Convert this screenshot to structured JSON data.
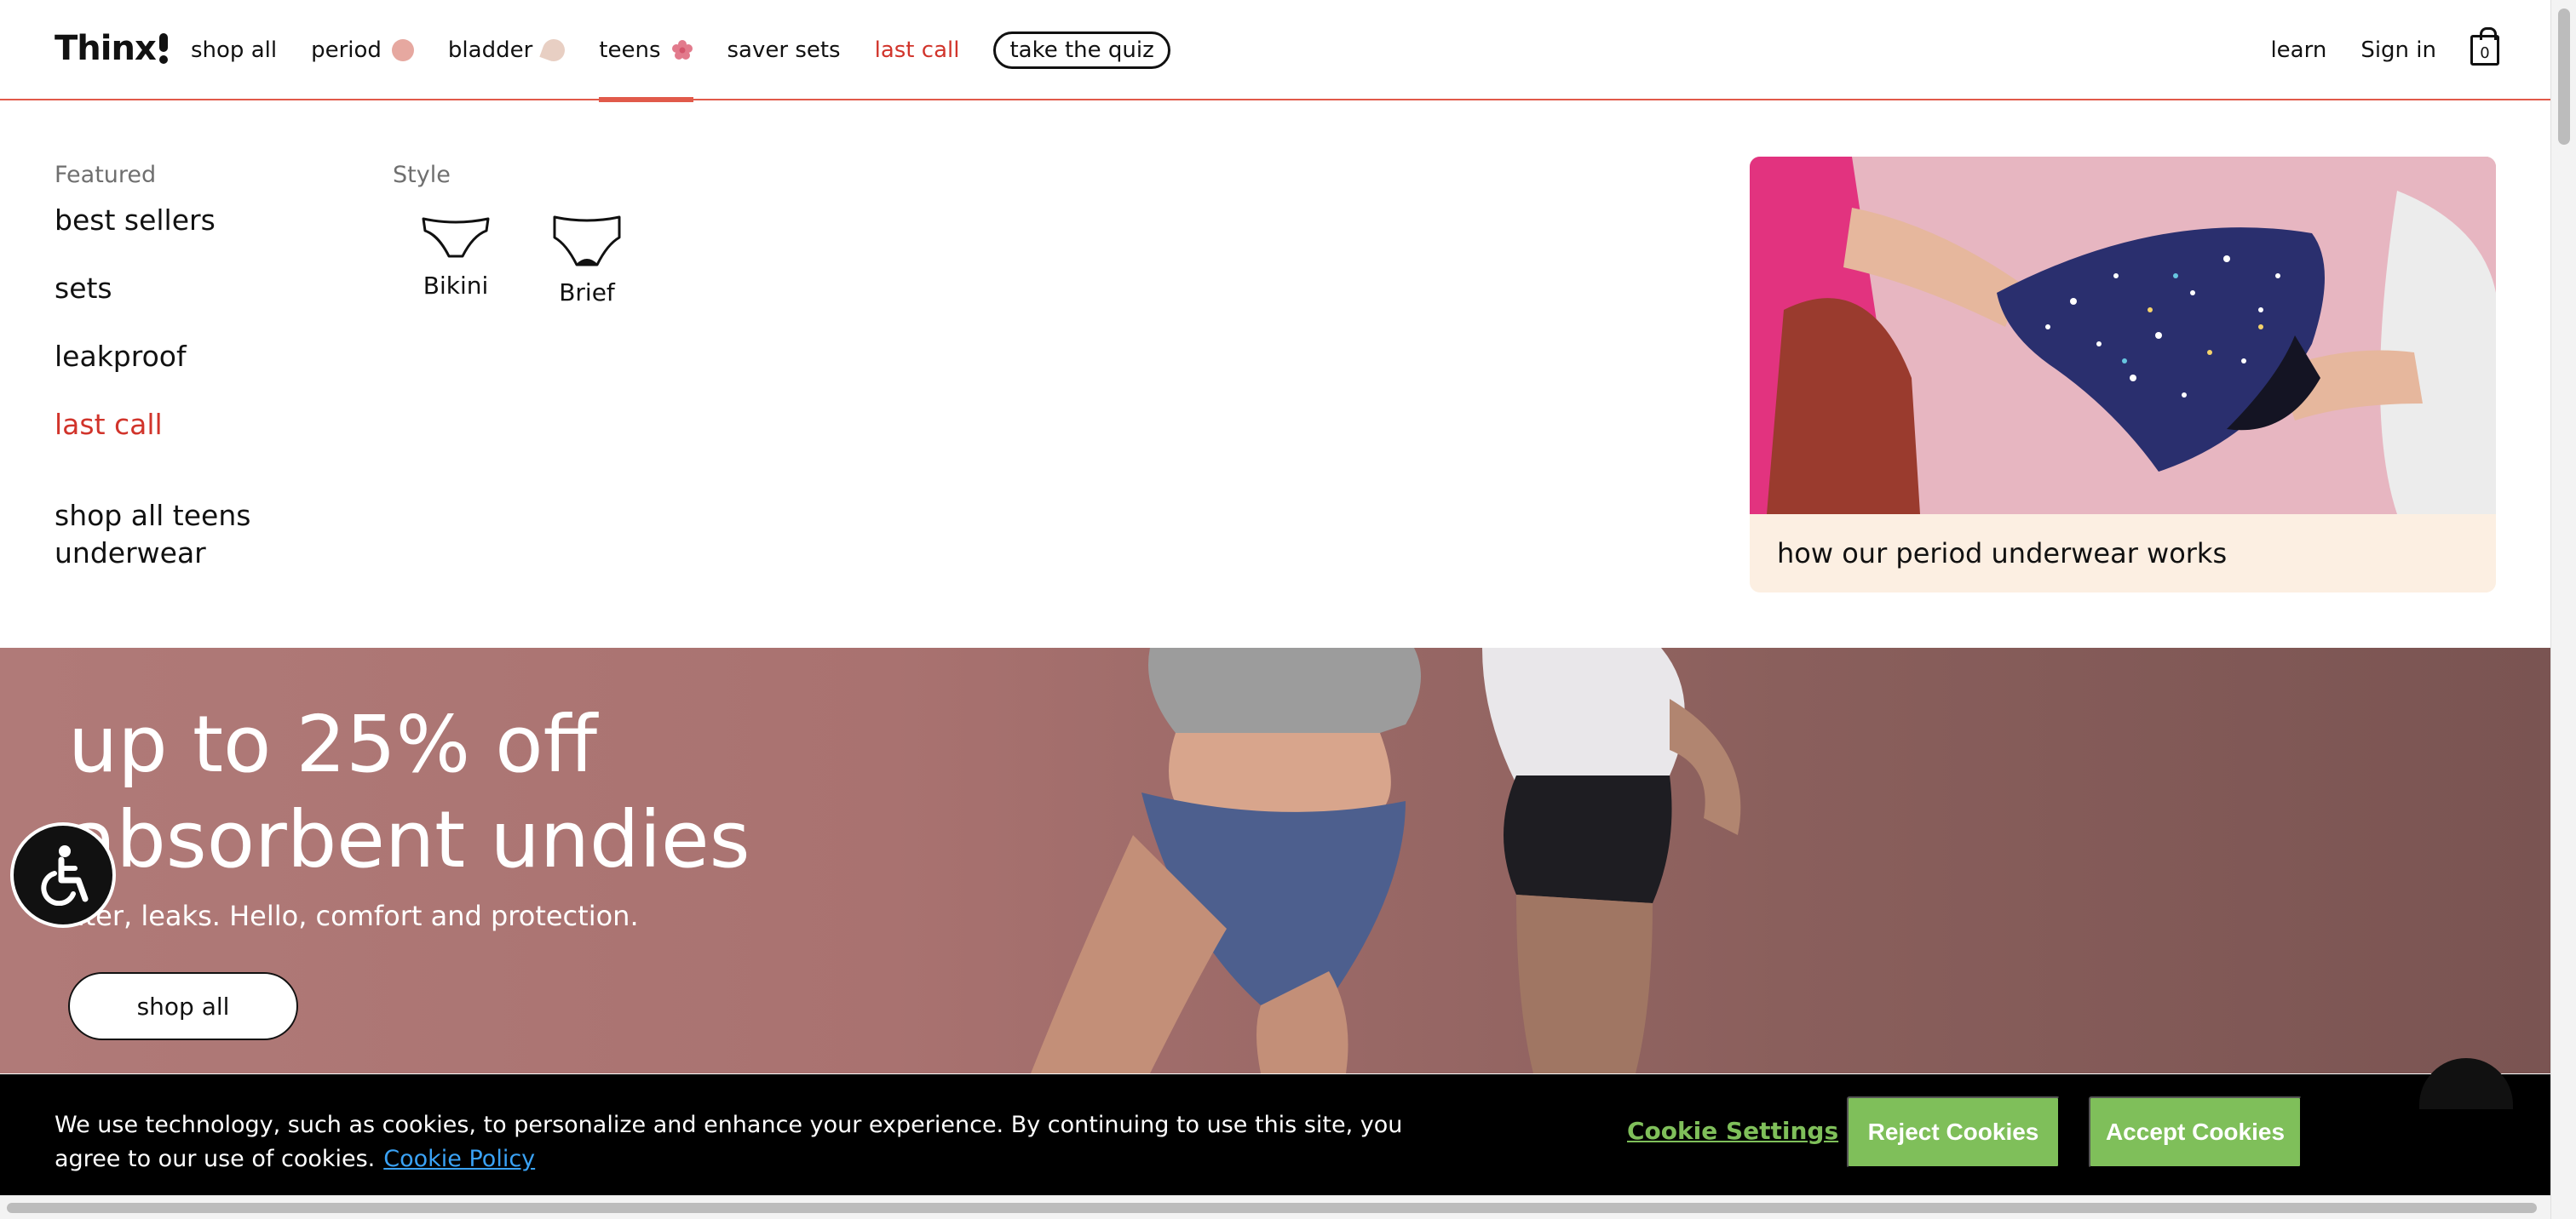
{
  "brand": {
    "logo_text": "Thinx"
  },
  "nav": {
    "items": [
      {
        "label": "shop all"
      },
      {
        "label": "period",
        "icon": "peach-circle-icon"
      },
      {
        "label": "bladder",
        "icon": "droplet-icon"
      },
      {
        "label": "teens",
        "icon": "flower-icon",
        "active": true
      },
      {
        "label": "saver sets"
      },
      {
        "label": "last call",
        "color": "#d1342b"
      }
    ],
    "quiz_label": "take the quiz",
    "learn_label": "learn",
    "signin_label": "Sign in",
    "cart_count": "0",
    "accent_color": "#e15a4a"
  },
  "dropdown": {
    "featured_title": "Featured",
    "featured_links": [
      "best sellers",
      "sets",
      "leakproof",
      "last call"
    ],
    "shop_all_label": "shop all teens underwear",
    "style_title": "Style",
    "styles": [
      {
        "label": "Bikini",
        "icon": "bikini-underwear-icon"
      },
      {
        "label": "Brief",
        "icon": "brief-underwear-icon"
      }
    ],
    "feature_card": {
      "caption": "how our period underwear works",
      "background": "#fcefe2"
    }
  },
  "hero": {
    "title_line1": "up to 25% off",
    "title_line2": "absorbent undies",
    "subtitle": "ater, leaks. Hello, comfort and protection.",
    "cta_label": "shop all"
  },
  "accessibility": {
    "icon": "accessibility-icon"
  },
  "cookie": {
    "text": "We use technology, such as cookies, to personalize and enhance your experience. By continuing to use this site, you agree to our use of cookies.",
    "policy_label": "Cookie Policy",
    "settings_label": "Cookie Settings",
    "reject_label": "Reject Cookies",
    "accept_label": "Accept Cookies",
    "button_color": "#7fbf5a"
  }
}
